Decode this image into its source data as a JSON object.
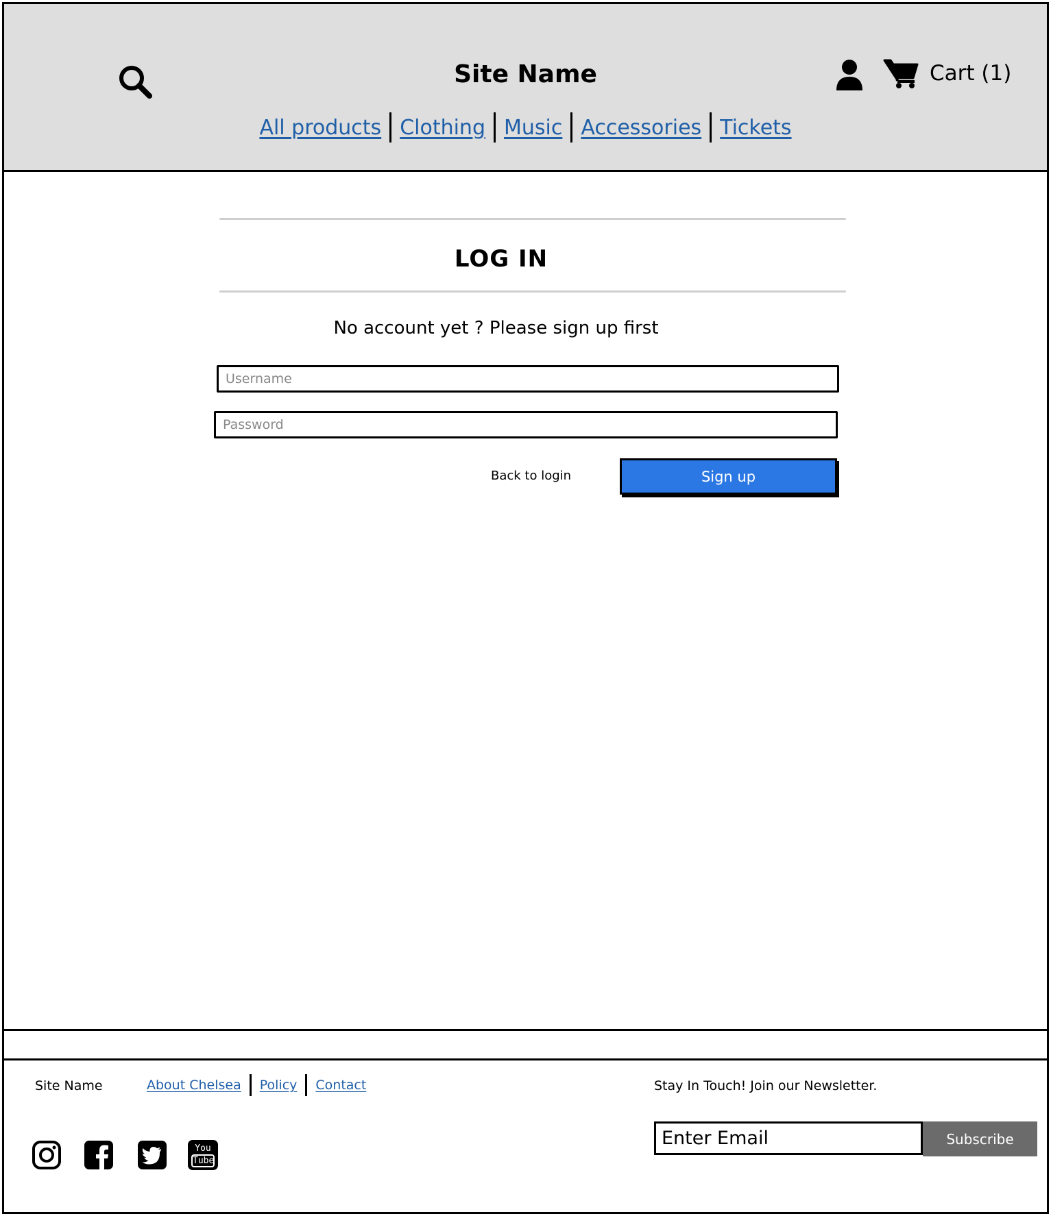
{
  "header": {
    "site_name": "Site Name",
    "cart_label": "Cart (1)",
    "nav": [
      "All products",
      "Clothing",
      "Music",
      "Accessories",
      "Tickets"
    ]
  },
  "main": {
    "title": "LOG IN",
    "hint": "No account yet ? Please sign up first",
    "username_placeholder": "Username",
    "password_placeholder": "Password",
    "back_label": "Back to login",
    "signup_label": "Sign up"
  },
  "footer": {
    "site_name": "Site Name",
    "links": [
      "About Chelsea",
      "Policy",
      "Contact"
    ],
    "newsletter_text": "Stay In Touch! Join our Newsletter.",
    "email_placeholder": "Enter Email",
    "subscribe_label": "Subscribe",
    "social": [
      "instagram-icon",
      "facebook-icon",
      "twitter-icon",
      "youtube-icon"
    ],
    "youtube_text": [
      "You",
      "Tube"
    ]
  },
  "colors": {
    "header_bg": "#dedede",
    "link": "#1f5fa8",
    "primary_button": "#2b78e4",
    "subscribe_button": "#6b6b6b"
  }
}
